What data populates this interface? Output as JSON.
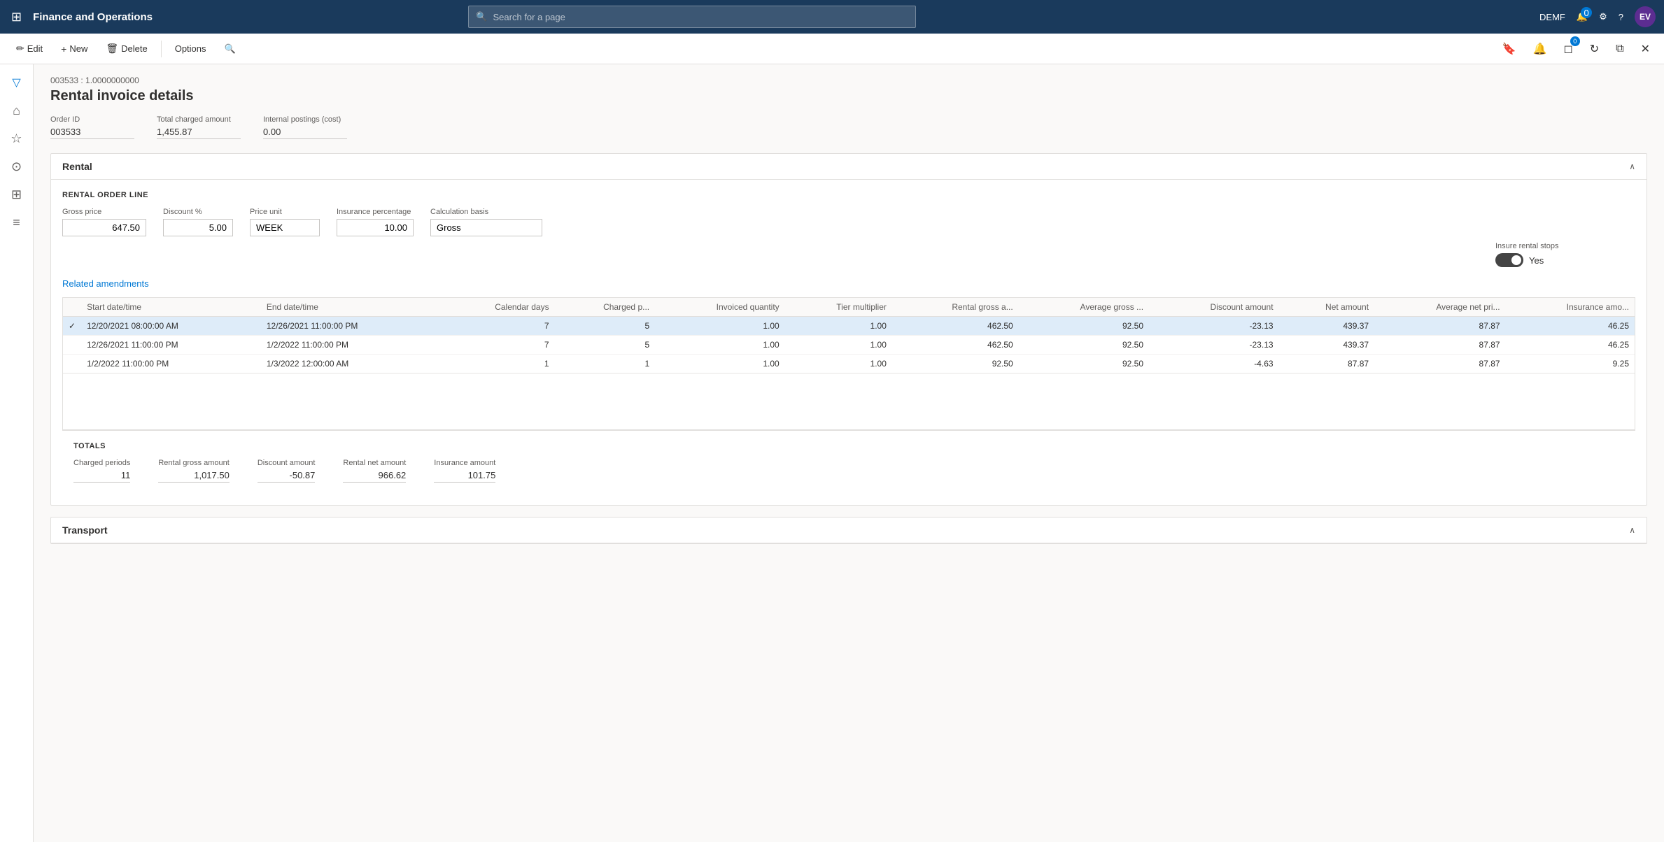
{
  "topNav": {
    "appTitle": "Finance and Operations",
    "searchPlaceholder": "Search for a page",
    "userCode": "DEMF",
    "userInitials": "EV",
    "notificationBadge": "0"
  },
  "toolbar": {
    "editLabel": "Edit",
    "newLabel": "New",
    "deleteLabel": "Delete",
    "optionsLabel": "Options"
  },
  "page": {
    "breadcrumb": "003533 : 1.0000000000",
    "title": "Rental invoice details"
  },
  "summaryFields": {
    "orderIdLabel": "Order ID",
    "orderId": "003533",
    "totalChargedLabel": "Total charged amount",
    "totalCharged": "1,455.87",
    "internalPostingsLabel": "Internal postings (cost)",
    "internalPostings": "0.00"
  },
  "rentalSection": {
    "title": "Rental",
    "subSectionTitle": "RENTAL ORDER LINE",
    "grossPriceLabel": "Gross price",
    "grossPrice": "647.50",
    "discountPctLabel": "Discount %",
    "discountPct": "5.00",
    "priceUnitLabel": "Price unit",
    "priceUnit": "WEEK",
    "insurancePctLabel": "Insurance percentage",
    "insurancePct": "10.00",
    "calcBasisLabel": "Calculation basis",
    "calcBasis": "Gross",
    "insureRentalStopsLabel": "Insure rental stops",
    "insureRentalStopsValue": "Yes",
    "relatedAmendmentsLink": "Related amendments",
    "tableColumns": [
      {
        "key": "check",
        "label": ""
      },
      {
        "key": "startDateTime",
        "label": "Start date/time"
      },
      {
        "key": "endDateTime",
        "label": "End date/time"
      },
      {
        "key": "calendarDays",
        "label": "Calendar days"
      },
      {
        "key": "chargedP",
        "label": "Charged p..."
      },
      {
        "key": "invoicedQty",
        "label": "Invoiced quantity"
      },
      {
        "key": "tierMultiplier",
        "label": "Tier multiplier"
      },
      {
        "key": "rentalGrossA",
        "label": "Rental gross a..."
      },
      {
        "key": "averageGross",
        "label": "Average gross ..."
      },
      {
        "key": "discountAmount",
        "label": "Discount amount"
      },
      {
        "key": "netAmount",
        "label": "Net amount"
      },
      {
        "key": "averageNetPri",
        "label": "Average net pri..."
      },
      {
        "key": "insuranceAmo",
        "label": "Insurance amo..."
      }
    ],
    "tableRows": [
      {
        "selected": true,
        "check": "✓",
        "startDateTime": "12/20/2021 08:00:00 AM",
        "endDateTime": "12/26/2021 11:00:00 PM",
        "calendarDays": "7",
        "chargedP": "5",
        "invoicedQty": "1.00",
        "tierMultiplier": "1.00",
        "rentalGrossA": "462.50",
        "averageGross": "92.50",
        "discountAmount": "-23.13",
        "netAmount": "439.37",
        "averageNetPri": "87.87",
        "insuranceAmo": "46.25"
      },
      {
        "selected": false,
        "check": "",
        "startDateTime": "12/26/2021 11:00:00 PM",
        "endDateTime": "1/2/2022 11:00:00 PM",
        "calendarDays": "7",
        "chargedP": "5",
        "invoicedQty": "1.00",
        "tierMultiplier": "1.00",
        "rentalGrossA": "462.50",
        "averageGross": "92.50",
        "discountAmount": "-23.13",
        "netAmount": "439.37",
        "averageNetPri": "87.87",
        "insuranceAmo": "46.25"
      },
      {
        "selected": false,
        "check": "",
        "startDateTime": "1/2/2022 11:00:00 PM",
        "endDateTime": "1/3/2022 12:00:00 AM",
        "calendarDays": "1",
        "chargedP": "1",
        "invoicedQty": "1.00",
        "tierMultiplier": "1.00",
        "rentalGrossA": "92.50",
        "averageGross": "92.50",
        "discountAmount": "-4.63",
        "netAmount": "87.87",
        "averageNetPri": "87.87",
        "insuranceAmo": "9.25"
      }
    ],
    "totals": {
      "title": "TOTALS",
      "chargedPeriodsLabel": "Charged periods",
      "chargedPeriods": "11",
      "rentalGrossAmtLabel": "Rental gross amount",
      "rentalGrossAmt": "1,017.50",
      "discountAmtLabel": "Discount amount",
      "discountAmt": "-50.87",
      "rentalNetAmtLabel": "Rental net amount",
      "rentalNetAmt": "966.62",
      "insuranceAmtLabel": "Insurance amount",
      "insuranceAmt": "101.75"
    }
  },
  "transportSection": {
    "title": "Transport"
  },
  "sidebar": {
    "icons": [
      {
        "name": "home",
        "symbol": "⌂"
      },
      {
        "name": "favorites",
        "symbol": "★"
      },
      {
        "name": "recent",
        "symbol": "⊙"
      },
      {
        "name": "workspaces",
        "symbol": "⊞"
      },
      {
        "name": "list",
        "symbol": "≡"
      }
    ]
  }
}
